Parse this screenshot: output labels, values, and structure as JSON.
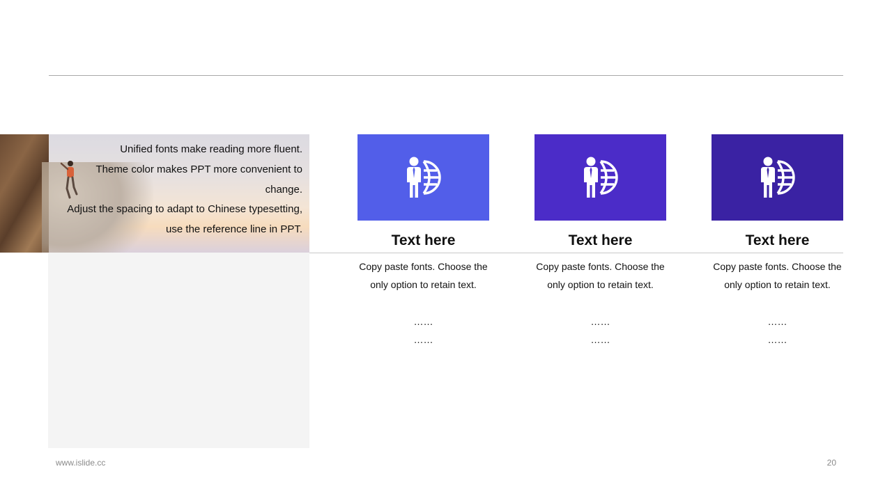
{
  "intro": {
    "lines": [
      "Unified fonts make reading more fluent.",
      "Theme color makes PPT more convenient to",
      "change.",
      "Adjust the spacing to adapt to Chinese typesetting,",
      "use the reference line in PPT."
    ]
  },
  "cards": [
    {
      "icon": "businessman-globe-icon",
      "color": "#525EE9",
      "title": "Text here",
      "body": "Copy paste fonts. Choose the only option to retain text.",
      "ellipsis": [
        "……",
        "……"
      ]
    },
    {
      "icon": "businessman-globe-icon",
      "color": "#4B2CC8",
      "title": "Text here",
      "body": "Copy paste fonts. Choose the only option to retain text.",
      "ellipsis": [
        "……",
        "……"
      ]
    },
    {
      "icon": "businessman-globe-icon",
      "color": "#3A22A3",
      "title": "Text here",
      "body": "Copy paste fonts. Choose the only option to retain text.",
      "ellipsis": [
        "……",
        "……"
      ]
    }
  ],
  "footer": {
    "url": "www.islide.cc",
    "page_number": "20"
  }
}
